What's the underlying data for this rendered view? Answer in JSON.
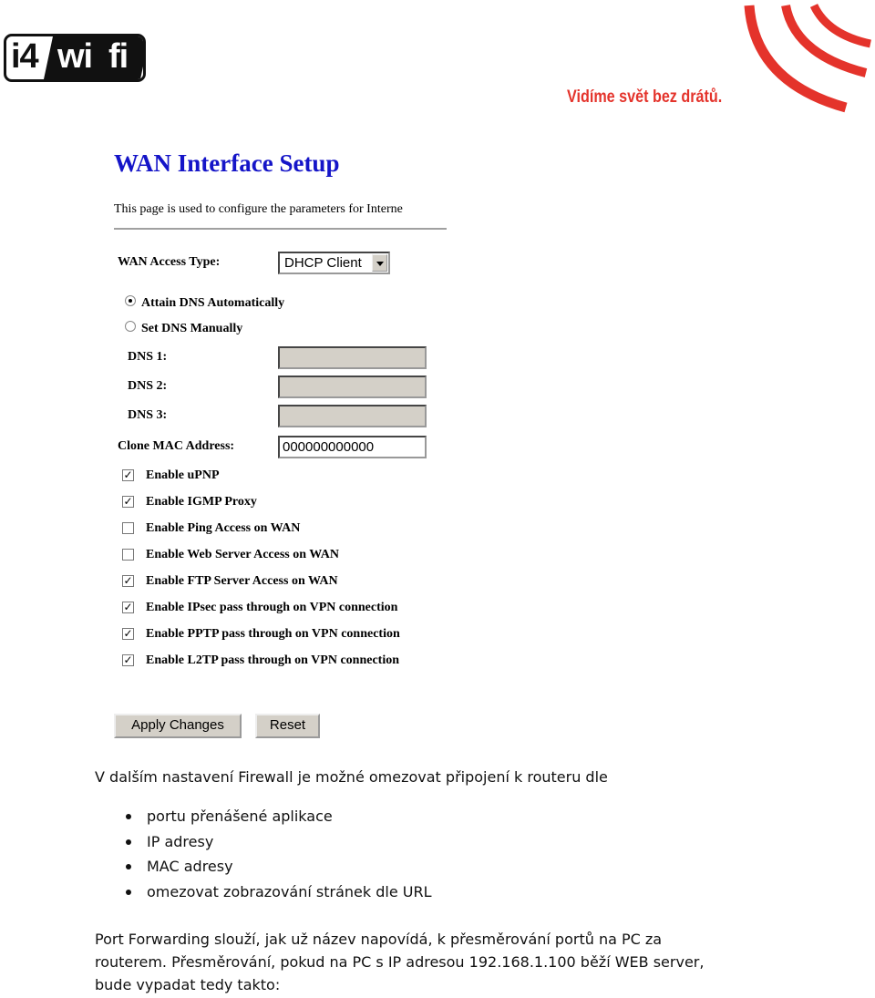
{
  "header": {
    "logo_text": "i4wifi",
    "tagline": "Vidíme svět bez drátů.",
    "brand_color": "#e4332b"
  },
  "form": {
    "title": "WAN Interface Setup",
    "description": "This page is used to configure the parameters for Interne",
    "wan_access_type_label": "WAN Access Type:",
    "wan_access_type_value": "DHCP Client",
    "dns_mode": [
      {
        "label": "Attain DNS Automatically",
        "selected": true
      },
      {
        "label": "Set DNS Manually",
        "selected": false
      }
    ],
    "dns_fields": [
      {
        "label": "DNS 1:",
        "value": ""
      },
      {
        "label": "DNS 2:",
        "value": ""
      },
      {
        "label": "DNS 3:",
        "value": ""
      }
    ],
    "clone_mac_label": "Clone MAC Address:",
    "clone_mac_value": "000000000000",
    "checkboxes": [
      {
        "label": "Enable uPNP",
        "checked": true
      },
      {
        "label": "Enable IGMP Proxy",
        "checked": true
      },
      {
        "label": "Enable Ping Access on WAN",
        "checked": false
      },
      {
        "label": "Enable Web Server Access on WAN",
        "checked": false
      },
      {
        "label": "Enable FTP Server Access on WAN",
        "checked": true
      },
      {
        "label": "Enable IPsec pass through on VPN connection",
        "checked": true
      },
      {
        "label": "Enable PPTP pass through on VPN connection",
        "checked": true
      },
      {
        "label": "Enable L2TP pass through on VPN connection",
        "checked": true
      }
    ],
    "apply_label": "Apply Changes",
    "reset_label": "Reset"
  },
  "body": {
    "intro": "V dalším nastavení Firewall je možné omezovat připojení k routeru dle",
    "bullets": [
      "portu přenášené aplikace",
      "IP adresy",
      "MAC adresy",
      "omezovat zobrazování stránek dle URL"
    ],
    "paragraph_lines": [
      "Port Forwarding slouží, jak už název napovídá, k přesměrování portů na PC za",
      "routerem. Přesměrování, pokud na PC s IP adresou 192.168.1.100 běží WEB server,",
      "bude vypadat tedy takto:"
    ]
  }
}
